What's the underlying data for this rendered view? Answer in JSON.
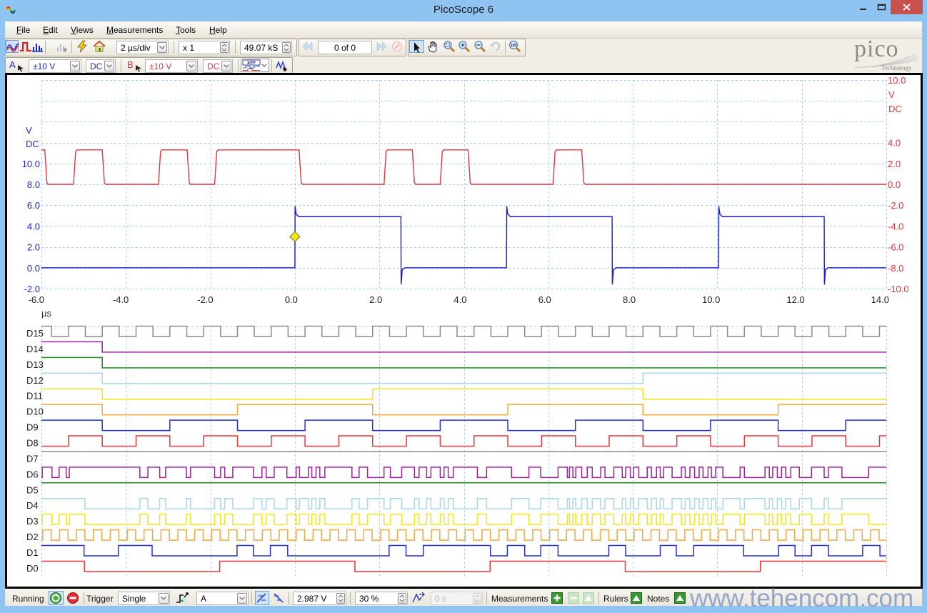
{
  "window": {
    "title": "PicoScope 6",
    "controls": [
      "minimize-icon",
      "maximize-icon",
      "close-icon"
    ]
  },
  "menu": {
    "items": [
      "File",
      "Edit",
      "Views",
      "Measurements",
      "Tools",
      "Help"
    ]
  },
  "toolbar": {
    "mode_buttons": [
      {
        "icon": "scope-mode-icon",
        "active": true
      },
      {
        "icon": "persistence-mode-icon",
        "active": false
      },
      {
        "icon": "spectrum-mode-icon",
        "active": false
      },
      {
        "icon": "serial-decoding-icon",
        "disabled": true
      },
      {
        "icon": "auto-setup-icon"
      },
      {
        "icon": "default-setup-home-icon"
      }
    ],
    "timebase": "2 µs/div",
    "zoom_factor": "x 1",
    "samples": "49.07 kS",
    "buffer_position": "0 of 0",
    "navigation_buttons": [
      {
        "icon": "buffer-back-icon",
        "disabled": true
      },
      {
        "icon": "buffer-forward-icon",
        "disabled": true
      },
      {
        "icon": "buffer-navigator-icon",
        "disabled": true
      }
    ],
    "view_tools": [
      {
        "icon": "pointer-tool-icon",
        "active": true
      },
      {
        "icon": "hand-tool-icon"
      },
      {
        "icon": "zoom-area-icon"
      },
      {
        "icon": "zoom-in-icon"
      },
      {
        "icon": "zoom-out-icon"
      },
      {
        "icon": "undo-zoom-icon",
        "disabled": true
      },
      {
        "icon": "zoom-to-fit-icon"
      }
    ]
  },
  "channels": {
    "a": {
      "label": "A",
      "range": "±10 V",
      "coupling": "DC",
      "color": "#2424c8"
    },
    "b": {
      "label": "B",
      "range": "±10 V",
      "coupling": "DC",
      "color": "#e0343c"
    },
    "extra_buttons": [
      "digital-channels-icon",
      "math-channels-icon"
    ]
  },
  "logo": {
    "brand": "pico",
    "tagline": "Technology"
  },
  "status": {
    "run_state": "Running",
    "trigger_label": "Trigger",
    "trigger_mode": "Single",
    "trigger_source": "A",
    "threshold": "2.987 V",
    "pre_trigger": "30 %",
    "post_trigger_delay": "0 s",
    "measurements_label": "Measurements",
    "rulers_label": "Rulers",
    "notes_label": "Notes",
    "edge_selected": "rising"
  },
  "watermark": "www.tehencom.com",
  "chart_data": {
    "type": "line",
    "title": "",
    "grid": true,
    "x_axis": {
      "label": "µs",
      "range": [
        -6,
        14
      ],
      "ticks": [
        -6,
        -4,
        -2,
        0,
        2,
        4,
        6,
        8,
        10,
        12,
        14
      ],
      "tick_labels": [
        "-6.0",
        "-4.0",
        "-2.0",
        "0.0",
        "2.0",
        "4.0",
        "6.0",
        "8.0",
        "10.0",
        "12.0",
        "14.0"
      ]
    },
    "y_axis_left": {
      "channel": "A",
      "unit": "V",
      "coupling": "DC",
      "range": [
        -2,
        18
      ],
      "major_step": 2,
      "ticks": [
        -2,
        0,
        2,
        4,
        6,
        8,
        10
      ],
      "tick_labels": [
        "-2.0",
        "0.0",
        "2.0",
        "4.0",
        "6.0",
        "8.0",
        "10.0"
      ],
      "color": "#2424c8"
    },
    "y_axis_right": {
      "channel": "B",
      "unit": "V",
      "coupling": "DC",
      "range": [
        -10,
        10
      ],
      "major_step": 2,
      "ticks": [
        10,
        4,
        2,
        0,
        -2,
        -4,
        -6,
        -8,
        -10
      ],
      "tick_labels": [
        "10.0",
        "4.0",
        "2.0",
        "0.0",
        "-2.0",
        "-4.0",
        "-6.0",
        "-8.0",
        "-10.0"
      ],
      "color": "#e0343c"
    },
    "series": [
      {
        "name": "A",
        "axis": "left",
        "color": "#1a1ac8",
        "initial_level": "low",
        "low_v": 0.0,
        "high_v": 4.9,
        "overshoot_v": 5.9,
        "undershoot_v": -1.6,
        "edges_us": [
          0.0,
          2.51,
          5.01,
          7.51,
          10.03,
          12.53
        ]
      },
      {
        "name": "B",
        "axis": "right",
        "color": "#e2363c",
        "initial_level": "high",
        "low_v": 0.0,
        "high_v": 3.3,
        "edges_us": [
          -5.92,
          -5.24,
          -4.56,
          -3.23,
          -2.55,
          -1.9,
          0.1,
          2.11,
          2.78,
          3.44,
          4.1,
          6.11,
          6.79
        ]
      }
    ],
    "trigger": {
      "channel": "A",
      "time_us": 0.0,
      "level_v": 2.987,
      "edge": "rising",
      "color": "#f5e61a"
    },
    "digital": [
      {
        "name": "D15",
        "color": "#8a8a8a",
        "clock": {
          "first_rise_us": -5.36,
          "period_us": 0.8,
          "high_us": 0.4
        }
      },
      {
        "name": "D14",
        "color": "#9c229c",
        "initial": 1,
        "edges_us": [
          -4.56
        ]
      },
      {
        "name": "D13",
        "color": "#1e8a1e",
        "initial": 1,
        "edges_us": [
          -4.56
        ]
      },
      {
        "name": "D12",
        "color": "#a9d6e6",
        "initial": 1,
        "edges_us": [
          -4.56,
          8.24
        ]
      },
      {
        "name": "D11",
        "color": "#f2e321",
        "initial": 1,
        "edges_us": [
          -4.56,
          1.84,
          8.24
        ]
      },
      {
        "name": "D10",
        "color": "#f0a83a",
        "clock": {
          "first_rise_us": -1.36,
          "period_us": 6.4,
          "high_us": 3.2
        }
      },
      {
        "name": "D9",
        "color": "#2630d2",
        "clock": {
          "first_rise_us": -2.96,
          "period_us": 3.2,
          "high_us": 1.6
        }
      },
      {
        "name": "D8",
        "color": "#ea3438",
        "clock": {
          "first_rise_us": -5.36,
          "period_us": 1.6,
          "high_us": 0.8
        }
      },
      {
        "name": "D7",
        "color": "#8a8a8a",
        "initial": 1,
        "edges_us": []
      },
      {
        "name": "D6",
        "color": "#9c229c",
        "initial": 0,
        "edges_us": [
          -5.98,
          -5.75,
          -5.58,
          -5.41,
          -5.34,
          -3.67,
          -3.48,
          -3.2,
          -3.06,
          -2.57,
          -2.47,
          -1.9,
          -1.76,
          -1.66,
          -1.47,
          -0.98,
          -0.78,
          -0.68,
          -0.49,
          -0.19,
          0.03,
          0.11,
          0.32,
          0.4,
          0.5,
          0.59,
          0.71,
          1.35,
          1.52,
          1.72,
          2.11,
          2.26,
          2.53,
          2.83,
          2.94,
          3.12,
          3.22,
          3.44,
          3.53,
          3.63,
          3.75,
          4.32,
          4.54,
          5.13,
          5.54,
          5.82,
          6.23,
          6.45,
          6.5,
          6.58,
          6.65,
          6.79,
          6.92,
          7.04,
          7.24,
          7.34,
          7.55,
          7.75,
          7.83,
          7.94,
          8.02,
          8.14,
          8.34,
          8.44,
          8.56,
          8.65,
          8.73,
          8.93,
          9.15,
          9.24,
          9.35,
          9.46,
          9.57,
          9.66,
          9.78,
          9.86,
          9.96,
          10.13,
          10.54,
          10.64,
          11.13,
          11.23,
          11.31,
          11.42,
          11.52,
          11.62,
          11.74,
          11.94,
          12.23,
          12.53,
          12.63,
          12.95,
          13.58
        ]
      },
      {
        "name": "D5",
        "color": "#1e8a1e",
        "initial": 1,
        "edges_us": []
      },
      {
        "name": "D4",
        "color": "#a9d6e6",
        "initial": 1,
        "edges_us": [
          -4.97,
          -3.67,
          -3.48,
          -3.2,
          -3.06,
          -2.57,
          -2.47,
          -1.9,
          -1.76,
          -1.66,
          -1.47,
          -0.98,
          -0.78,
          -0.68,
          -0.49,
          -0.19,
          0.03,
          0.11,
          0.32,
          0.4,
          0.5,
          0.59,
          0.71,
          1.35,
          1.52,
          1.72,
          2.11,
          2.26,
          2.53,
          2.83,
          2.94,
          3.12,
          3.22,
          3.44,
          3.53,
          3.63,
          3.75,
          4.32,
          4.54,
          5.13,
          5.54,
          5.82,
          6.23,
          6.45,
          6.5,
          6.58,
          6.65,
          6.79,
          6.92,
          7.04,
          7.24,
          7.34,
          7.55,
          7.75,
          7.83,
          7.94,
          8.02,
          8.14,
          8.34,
          8.44,
          8.56,
          8.65,
          8.73,
          8.93,
          9.15,
          9.24,
          9.35,
          9.46,
          9.57,
          9.66,
          9.78,
          9.86,
          9.96,
          10.13,
          10.54,
          10.64,
          11.13,
          11.23,
          11.31,
          11.42,
          11.52,
          11.62,
          11.74,
          11.94,
          12.23,
          12.53,
          12.63,
          12.95
        ]
      },
      {
        "name": "D3",
        "color": "#f2e321",
        "initial": 0,
        "edges_us": [
          -5.98,
          -5.75,
          -5.58,
          -5.41,
          -5.34,
          -4.97,
          -3.67,
          -3.48,
          -3.2,
          -3.06,
          -2.57,
          -2.47,
          -1.9,
          -1.76,
          -1.66,
          -1.47,
          -0.98,
          -0.78,
          -0.68,
          -0.49,
          -0.19,
          0.03,
          0.11,
          0.32,
          0.4,
          0.5,
          0.59,
          0.71,
          1.35,
          1.52,
          1.72,
          2.11,
          2.26,
          2.53,
          2.83,
          2.94,
          3.12,
          3.22,
          3.44,
          3.53,
          3.63,
          3.75,
          4.32,
          4.54,
          5.13,
          5.54,
          5.82,
          6.23,
          6.45,
          6.5,
          6.58,
          6.65,
          6.79,
          6.92,
          7.04,
          7.24,
          7.34,
          7.55,
          7.75,
          7.83,
          7.94,
          8.02,
          8.14,
          8.34,
          8.44,
          8.56,
          8.65,
          8.73,
          8.93,
          9.15,
          9.24,
          9.35,
          9.46,
          9.57,
          9.66,
          9.78,
          9.86,
          9.96,
          10.13,
          10.54,
          10.64,
          11.13,
          11.23,
          11.31,
          11.42,
          11.52,
          11.62,
          11.74,
          11.94,
          12.23,
          12.53,
          12.63,
          12.95,
          13.58
        ]
      },
      {
        "name": "D2",
        "color": "#f0a83a",
        "clock": {
          "first_rise_us": -5.97,
          "period_us": 0.4,
          "high_us": 0.2
        }
      },
      {
        "name": "D1",
        "color": "#2630d2",
        "initial": 1,
        "edges_us": [
          -4.99,
          -4.18,
          -3.38,
          -1.37,
          -0.98,
          -0.58,
          -0.17,
          2.23,
          2.63,
          3.04,
          4.63,
          5.03,
          5.44,
          5.82,
          6.23,
          7.43,
          7.83,
          8.65,
          9.03,
          9.44,
          10.62,
          11.45,
          11.84,
          12.23,
          12.63,
          13.44,
          13.85
        ]
      },
      {
        "name": "D0",
        "color": "#ea3438",
        "clock": {
          "first_rise_us": -1.78,
          "period_us": 6.4,
          "high_us": 3.2
        }
      }
    ]
  }
}
